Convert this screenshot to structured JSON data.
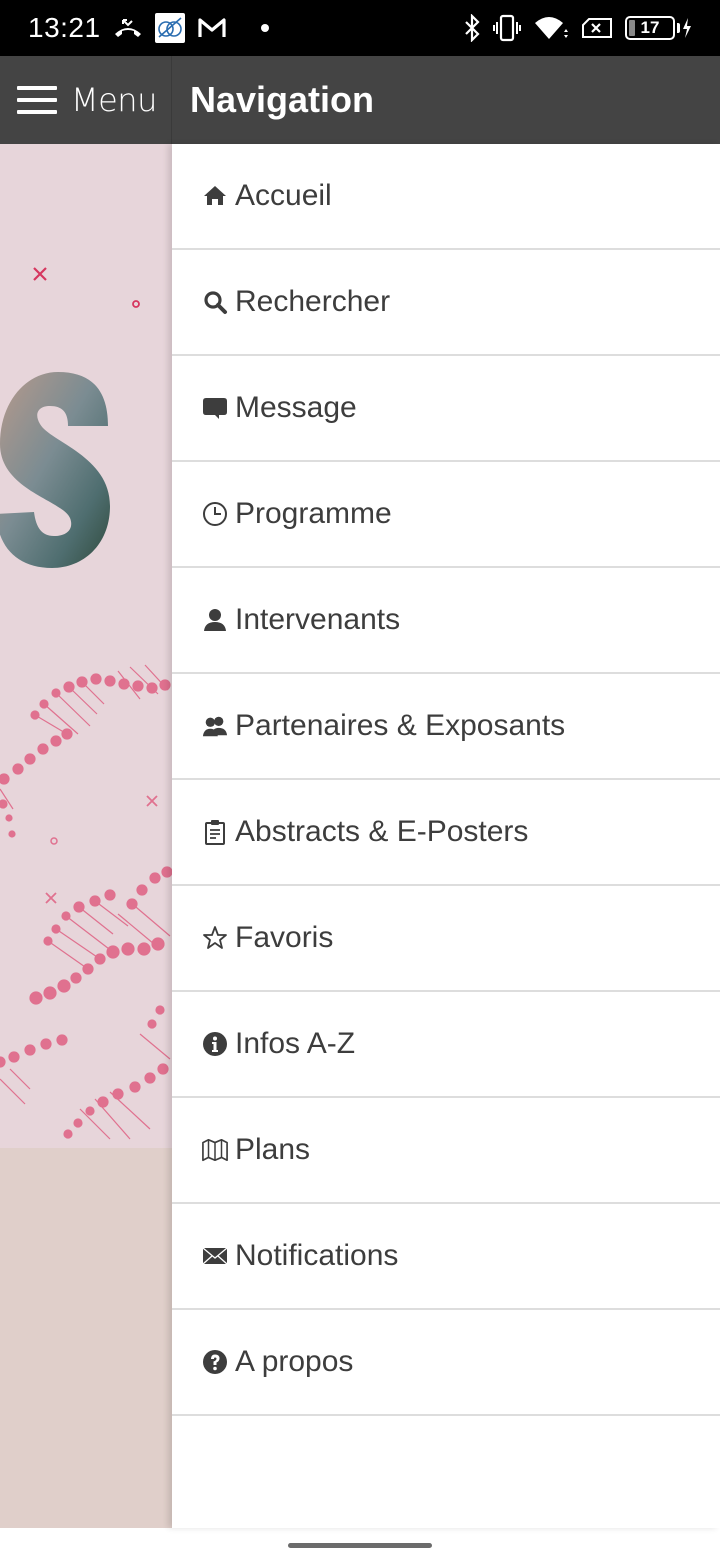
{
  "status_bar": {
    "time": "13:21",
    "left_icons": [
      "missed-call-icon",
      "app-badge-icon",
      "gmail-icon",
      "notification-dot"
    ],
    "right_icons": [
      "bluetooth-icon",
      "vibrate-icon",
      "wifi-icon",
      "no-sim-icon",
      "battery-icon",
      "charging-icon"
    ],
    "battery_level": "17"
  },
  "header": {
    "menu_label": "Menu",
    "title": "Navigation"
  },
  "nav": {
    "items": [
      {
        "label": "Accueil",
        "icon": "home-icon"
      },
      {
        "label": "Rechercher",
        "icon": "search-icon"
      },
      {
        "label": "Message",
        "icon": "chat-bubble-icon"
      },
      {
        "label": "Programme",
        "icon": "clock-icon"
      },
      {
        "label": "Intervenants",
        "icon": "user-icon"
      },
      {
        "label": "Partenaires & Exposants",
        "icon": "users-icon"
      },
      {
        "label": "Abstracts & E-Posters",
        "icon": "clipboard-icon"
      },
      {
        "label": "Favoris",
        "icon": "star-outline-icon"
      },
      {
        "label": "Infos A-Z",
        "icon": "info-circle-icon"
      },
      {
        "label": "Plans",
        "icon": "map-icon"
      },
      {
        "label": "Notifications",
        "icon": "envelope-icon"
      },
      {
        "label": "A propos",
        "icon": "question-circle-icon"
      }
    ]
  },
  "colors": {
    "header_bg": "#444444",
    "drawer_bg": "#ffffff",
    "text": "#3d3d3d",
    "divider": "#dddddd",
    "background_art": "#e7d5da",
    "accent_pink": "#e0718f"
  }
}
